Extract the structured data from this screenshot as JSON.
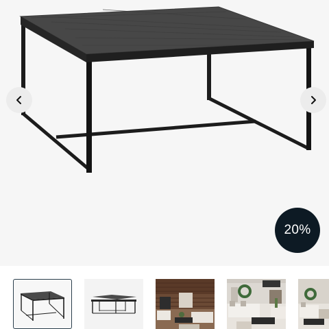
{
  "gallery": {
    "product_image_name": "square-coffee-table-dark-wood-top-black-metal-frame",
    "prev_icon": "chevron-left-icon",
    "next_icon": "chevron-right-icon",
    "discount_badge": "20%",
    "active_thumbnail": 1,
    "thumbnails": [
      {
        "name": "coffee-table-front-view"
      },
      {
        "name": "coffee-table-side-view"
      },
      {
        "name": "living-room-scene-wood-interior"
      },
      {
        "name": "living-room-scene-wreath"
      },
      {
        "name": "living-room-scene-partial"
      }
    ]
  },
  "colors": {
    "viewer_background": "#f6f6f6",
    "nav_button": "#ececec",
    "badge_background": "#0d1a24",
    "badge_text": "#ffffff",
    "active_thumb_border": "#2a3e4c"
  }
}
